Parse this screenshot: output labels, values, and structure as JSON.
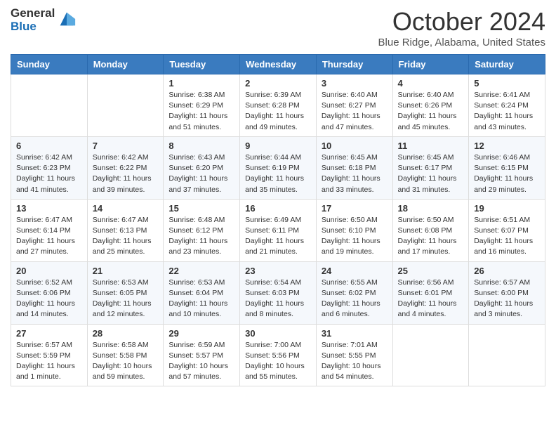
{
  "logo": {
    "general": "General",
    "blue": "Blue"
  },
  "title": "October 2024",
  "subtitle": "Blue Ridge, Alabama, United States",
  "days_of_week": [
    "Sunday",
    "Monday",
    "Tuesday",
    "Wednesday",
    "Thursday",
    "Friday",
    "Saturday"
  ],
  "weeks": [
    [
      {
        "day": "",
        "info": ""
      },
      {
        "day": "",
        "info": ""
      },
      {
        "day": "1",
        "info": "Sunrise: 6:38 AM\nSunset: 6:29 PM\nDaylight: 11 hours and 51 minutes."
      },
      {
        "day": "2",
        "info": "Sunrise: 6:39 AM\nSunset: 6:28 PM\nDaylight: 11 hours and 49 minutes."
      },
      {
        "day": "3",
        "info": "Sunrise: 6:40 AM\nSunset: 6:27 PM\nDaylight: 11 hours and 47 minutes."
      },
      {
        "day": "4",
        "info": "Sunrise: 6:40 AM\nSunset: 6:26 PM\nDaylight: 11 hours and 45 minutes."
      },
      {
        "day": "5",
        "info": "Sunrise: 6:41 AM\nSunset: 6:24 PM\nDaylight: 11 hours and 43 minutes."
      }
    ],
    [
      {
        "day": "6",
        "info": "Sunrise: 6:42 AM\nSunset: 6:23 PM\nDaylight: 11 hours and 41 minutes."
      },
      {
        "day": "7",
        "info": "Sunrise: 6:42 AM\nSunset: 6:22 PM\nDaylight: 11 hours and 39 minutes."
      },
      {
        "day": "8",
        "info": "Sunrise: 6:43 AM\nSunset: 6:20 PM\nDaylight: 11 hours and 37 minutes."
      },
      {
        "day": "9",
        "info": "Sunrise: 6:44 AM\nSunset: 6:19 PM\nDaylight: 11 hours and 35 minutes."
      },
      {
        "day": "10",
        "info": "Sunrise: 6:45 AM\nSunset: 6:18 PM\nDaylight: 11 hours and 33 minutes."
      },
      {
        "day": "11",
        "info": "Sunrise: 6:45 AM\nSunset: 6:17 PM\nDaylight: 11 hours and 31 minutes."
      },
      {
        "day": "12",
        "info": "Sunrise: 6:46 AM\nSunset: 6:15 PM\nDaylight: 11 hours and 29 minutes."
      }
    ],
    [
      {
        "day": "13",
        "info": "Sunrise: 6:47 AM\nSunset: 6:14 PM\nDaylight: 11 hours and 27 minutes."
      },
      {
        "day": "14",
        "info": "Sunrise: 6:47 AM\nSunset: 6:13 PM\nDaylight: 11 hours and 25 minutes."
      },
      {
        "day": "15",
        "info": "Sunrise: 6:48 AM\nSunset: 6:12 PM\nDaylight: 11 hours and 23 minutes."
      },
      {
        "day": "16",
        "info": "Sunrise: 6:49 AM\nSunset: 6:11 PM\nDaylight: 11 hours and 21 minutes."
      },
      {
        "day": "17",
        "info": "Sunrise: 6:50 AM\nSunset: 6:10 PM\nDaylight: 11 hours and 19 minutes."
      },
      {
        "day": "18",
        "info": "Sunrise: 6:50 AM\nSunset: 6:08 PM\nDaylight: 11 hours and 17 minutes."
      },
      {
        "day": "19",
        "info": "Sunrise: 6:51 AM\nSunset: 6:07 PM\nDaylight: 11 hours and 16 minutes."
      }
    ],
    [
      {
        "day": "20",
        "info": "Sunrise: 6:52 AM\nSunset: 6:06 PM\nDaylight: 11 hours and 14 minutes."
      },
      {
        "day": "21",
        "info": "Sunrise: 6:53 AM\nSunset: 6:05 PM\nDaylight: 11 hours and 12 minutes."
      },
      {
        "day": "22",
        "info": "Sunrise: 6:53 AM\nSunset: 6:04 PM\nDaylight: 11 hours and 10 minutes."
      },
      {
        "day": "23",
        "info": "Sunrise: 6:54 AM\nSunset: 6:03 PM\nDaylight: 11 hours and 8 minutes."
      },
      {
        "day": "24",
        "info": "Sunrise: 6:55 AM\nSunset: 6:02 PM\nDaylight: 11 hours and 6 minutes."
      },
      {
        "day": "25",
        "info": "Sunrise: 6:56 AM\nSunset: 6:01 PM\nDaylight: 11 hours and 4 minutes."
      },
      {
        "day": "26",
        "info": "Sunrise: 6:57 AM\nSunset: 6:00 PM\nDaylight: 11 hours and 3 minutes."
      }
    ],
    [
      {
        "day": "27",
        "info": "Sunrise: 6:57 AM\nSunset: 5:59 PM\nDaylight: 11 hours and 1 minute."
      },
      {
        "day": "28",
        "info": "Sunrise: 6:58 AM\nSunset: 5:58 PM\nDaylight: 10 hours and 59 minutes."
      },
      {
        "day": "29",
        "info": "Sunrise: 6:59 AM\nSunset: 5:57 PM\nDaylight: 10 hours and 57 minutes."
      },
      {
        "day": "30",
        "info": "Sunrise: 7:00 AM\nSunset: 5:56 PM\nDaylight: 10 hours and 55 minutes."
      },
      {
        "day": "31",
        "info": "Sunrise: 7:01 AM\nSunset: 5:55 PM\nDaylight: 10 hours and 54 minutes."
      },
      {
        "day": "",
        "info": ""
      },
      {
        "day": "",
        "info": ""
      }
    ]
  ]
}
